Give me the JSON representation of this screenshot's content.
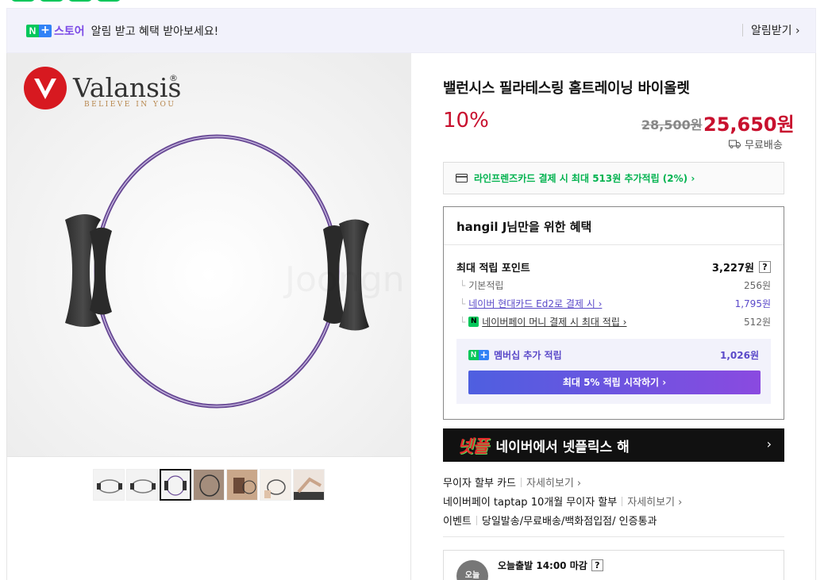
{
  "banner": {
    "np_n": "N",
    "np_plus": "+",
    "store_label": "스토어",
    "message": "알림 받고 혜택 받아보세요!",
    "alarm_button": "알림받기",
    "alarm_chevron": "›"
  },
  "gallery": {
    "brand_name": "Valansis",
    "brand_mark": "®",
    "brand_slogan": "BELIEVE IN YOU",
    "watermark": "Joongn",
    "thumbnail_count": 7,
    "active_thumbnail": 3
  },
  "product": {
    "title": "밸런시스 필라테스링 홈트레이닝 바이올렛",
    "discount": "10%",
    "original_price": "28,500원",
    "sale_price": "25,650원",
    "shipping": "무료배송"
  },
  "card_promo": {
    "text": "라인프렌즈카드 결제 시 최대 513원 추가적립 (2%) ›"
  },
  "benefits": {
    "header": "hangil J님만을 위한 혜택",
    "max_points_label": "최대 적립 포인트",
    "max_points_value": "3,227원",
    "help": "?",
    "rows": [
      {
        "label": "기본적립",
        "value": "256원"
      },
      {
        "label": "네이버 현대카드 Ed2로 결제 시 ›",
        "value": "1,795원"
      },
      {
        "label": "네이버페이 머니 결제 시 최대 적립 ›",
        "value": "512원"
      }
    ],
    "membership_label": "멤버십 추가 적립",
    "membership_value": "1,026원",
    "membership_button": "최대 5% 적립 시작하기 ›"
  },
  "ad": {
    "logo": "넷플",
    "text": "네이버에서 넷플릭스 해",
    "arrow": "›"
  },
  "info": {
    "installment_label": "무이자 할부 카드",
    "installment_more": "자세히보기 ›",
    "taptap_label": "네이버페이 taptap 10개월 무이자 할부",
    "taptap_more": "자세히보기 ›",
    "event_label": "이벤트",
    "event_text": "당일발송/무료배송/백화점입점/ 인증통과"
  },
  "delivery": {
    "icon_text": "오늘",
    "deadline": "오늘출발 14:00 마감",
    "help": "?"
  },
  "colors": {
    "accent_red": "#c8102e",
    "naver_green": "#03c75a",
    "purple": "#5a49c9"
  }
}
